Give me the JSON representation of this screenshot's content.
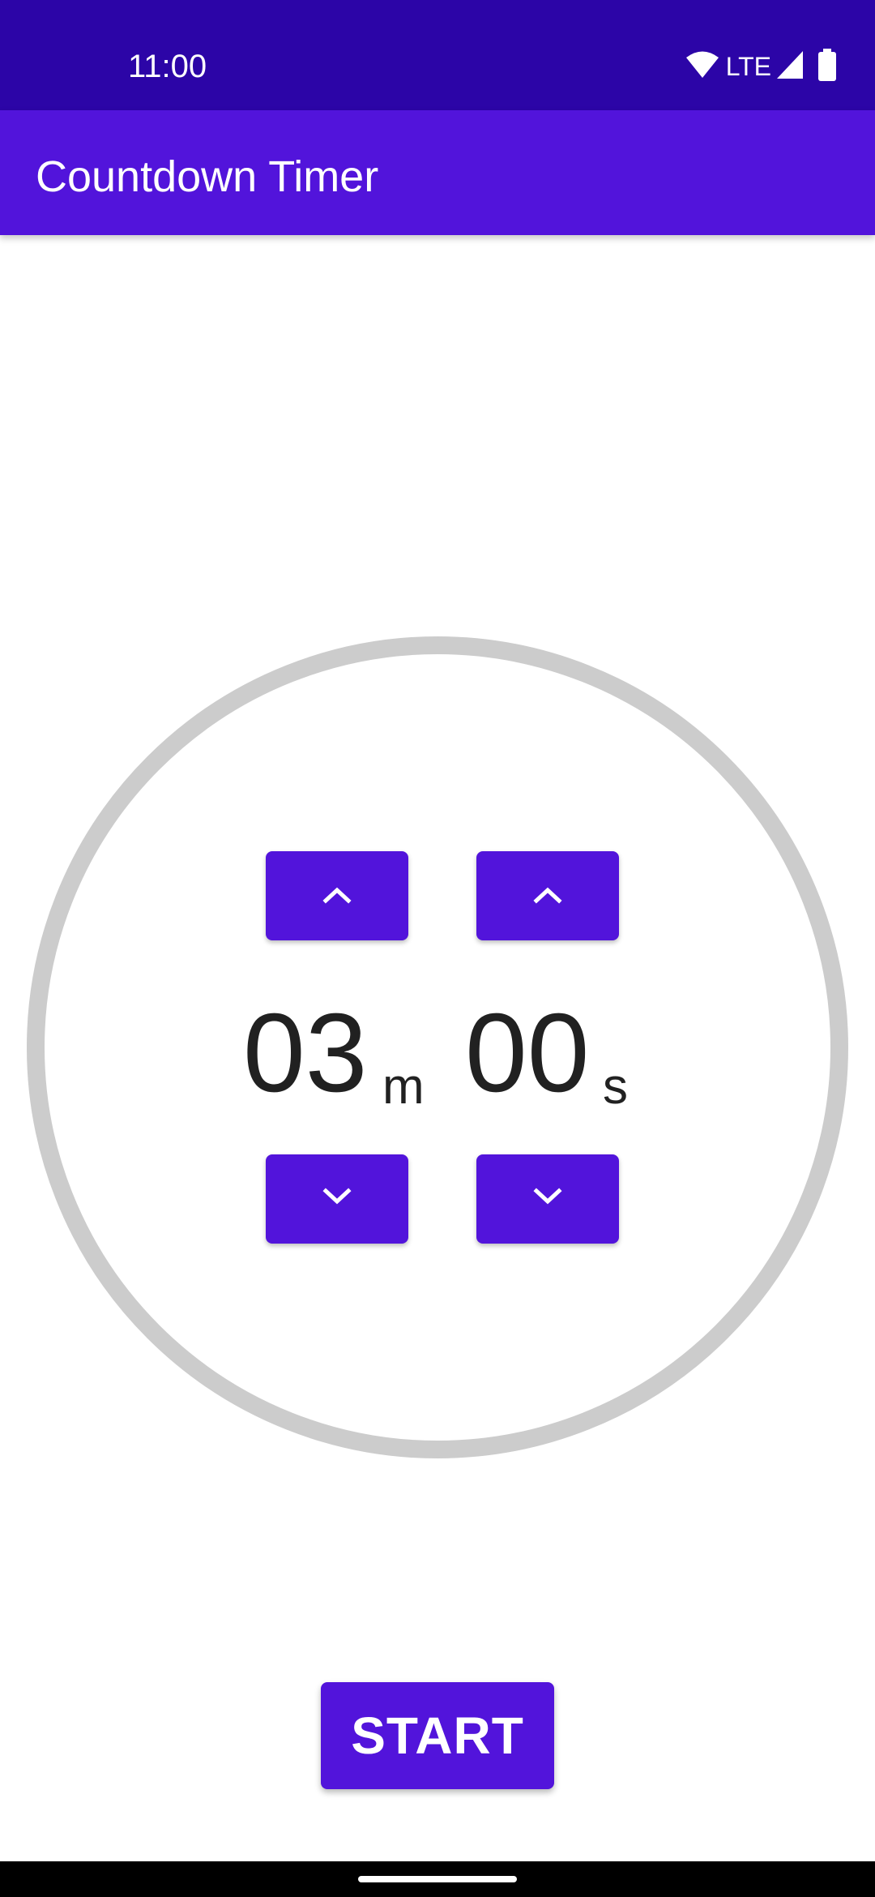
{
  "status_bar": {
    "time": "11:00",
    "network_label": "LTE",
    "icons": [
      "wifi-icon",
      "cell-signal-icon",
      "battery-icon"
    ]
  },
  "app_bar": {
    "title": "Countdown Timer"
  },
  "timer": {
    "minutes": "03",
    "minutes_unit": "m",
    "seconds": "00",
    "seconds_unit": "s",
    "controls": {
      "increment_icon": "chevron-up-icon",
      "decrement_icon": "chevron-down-icon"
    }
  },
  "actions": {
    "start_label": "START"
  },
  "colors": {
    "status_bar": "#2c05a7",
    "primary": "#5214db",
    "ring": "#cccccc",
    "text": "#212121"
  }
}
